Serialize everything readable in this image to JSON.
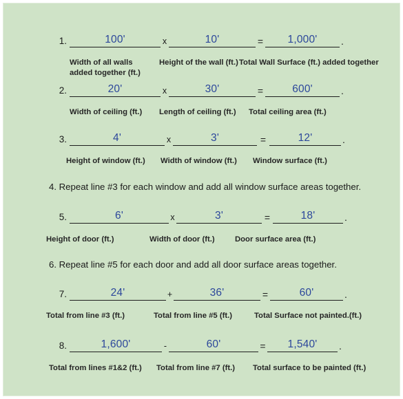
{
  "page": {
    "background_color": "#cfe3c7",
    "value_color": "#2c479b",
    "text_color": "#1a1a1a",
    "rule_color": "#1d1d1d"
  },
  "lines": [
    {
      "number": "1.",
      "operator": "x",
      "equals": "=",
      "period": ".",
      "values": [
        "100'",
        "10'",
        "1,000'"
      ],
      "captions": [
        "Width of all walls\nadded together (ft.)",
        "Height of the wall (ft.)",
        "Total Wall Surface (ft.) added together"
      ]
    },
    {
      "number": "2.",
      "operator": "x",
      "equals": "=",
      "period": ".",
      "values": [
        "20'",
        "30'",
        "600'"
      ],
      "captions": [
        "Width of ceiling (ft.)",
        "Length of ceiling (ft.)",
        "Total ceiling area (ft.)"
      ]
    },
    {
      "number": "3.",
      "operator": "x",
      "equals": "=",
      "period": ".",
      "values": [
        "4'",
        "3'",
        "12'"
      ],
      "captions": [
        "Height of window (ft.)",
        "Width of window (ft.)",
        "Window surface (ft.)"
      ]
    },
    {
      "number": "5.",
      "operator": "x",
      "equals": "=",
      "period": ".",
      "values": [
        "6'",
        "3'",
        "18'"
      ],
      "captions": [
        "Height of door (ft.)",
        "Width of door (ft.)",
        "Door surface area (ft.)"
      ]
    },
    {
      "number": "7.",
      "operator": "+",
      "equals": "=",
      "period": ".",
      "values": [
        "24'",
        "36'",
        "60'"
      ],
      "captions": [
        "Total from line #3 (ft.)",
        "Total from line #5 (ft.)",
        "Total Surface not painted.(ft.)"
      ]
    },
    {
      "number": "8.",
      "operator": "-",
      "equals": "=",
      "period": ".",
      "values": [
        "1,600'",
        "60'",
        "1,540'"
      ],
      "captions": [
        "Total from lines #1&2 (ft.)",
        "Total from line #7 (ft.)",
        "Total surface to be painted (ft.)"
      ]
    }
  ],
  "instructions": [
    "4. Repeat line #3 for each window and add all window surface areas together.",
    "6. Repeat line #5 for each door and add all door surface areas together."
  ]
}
